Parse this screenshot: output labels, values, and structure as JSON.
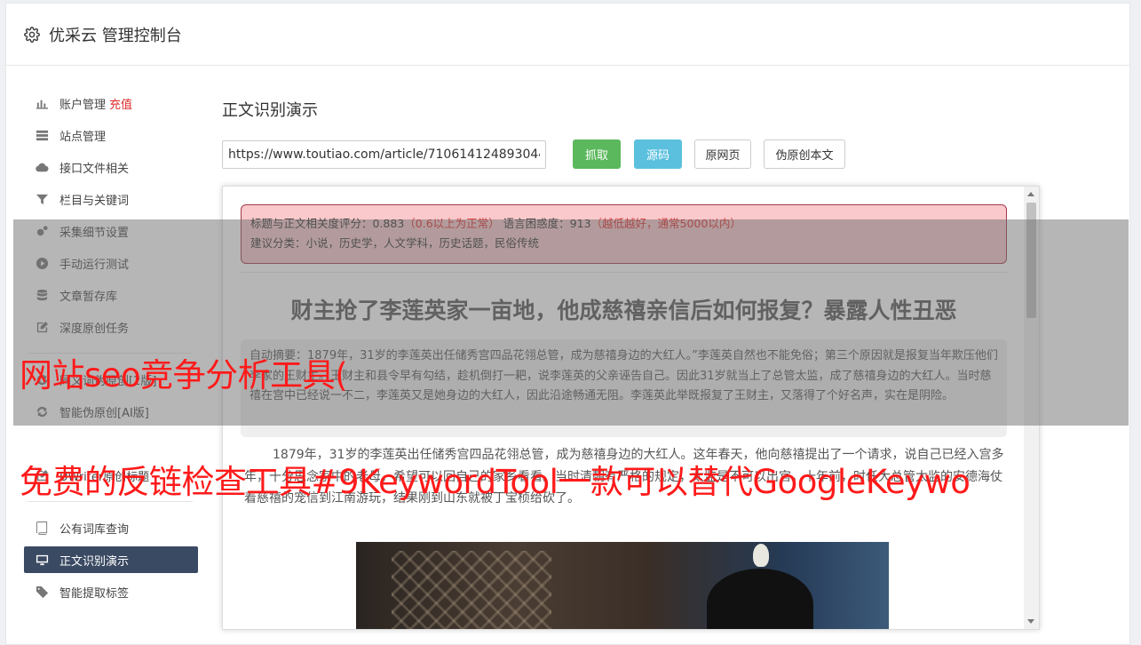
{
  "header": {
    "title": "优采云 管理控制台",
    "icon": "gear-icon"
  },
  "sidebar": {
    "items": [
      {
        "label": "账户管理",
        "extra": "充值",
        "icon": "chart-bar-icon"
      },
      {
        "label": "站点管理",
        "icon": "server-icon"
      },
      {
        "label": "接口文件相关",
        "icon": "cloud-download-icon"
      },
      {
        "label": "栏目与关键词",
        "icon": "filter-icon"
      },
      {
        "label": "采集细节设置",
        "icon": "cogs-icon"
      },
      {
        "label": "手动运行测试",
        "icon": "play-circle-icon"
      },
      {
        "label": "文章暂存库",
        "icon": "database-icon"
      },
      {
        "label": "深度原创任务",
        "icon": "edit-icon"
      },
      {
        "label": "同义词伪原创[2版]",
        "icon": "refresh-icon"
      },
      {
        "label": "智能伪原创[AI版]",
        "icon": "refresh-icon"
      },
      {
        "label": "UWriter原创标题",
        "icon": "edit-icon"
      },
      {
        "label": "公有词库查询",
        "icon": "book-icon"
      },
      {
        "label": "正文识别演示",
        "icon": "desktop-icon",
        "active": true
      },
      {
        "label": "智能提取标签",
        "icon": "tag-icon"
      }
    ]
  },
  "main": {
    "page_title": "正文识别演示",
    "url_value": "https://www.toutiao.com/article/7106141248930447",
    "buttons": {
      "fetch": "抓取",
      "source": "源码",
      "origin": "原网页",
      "rewrite": "伪原创本文"
    },
    "notice": {
      "score_label": "标题与正文相关度评分：0.883",
      "score_hint": "（0.6以上为正常）",
      "confusion_label": "语言困惑度：913",
      "confusion_hint": "（越低越好，通常5000以内）",
      "category": "建议分类：小说，历史学，人文学科，历史话题，民俗传统"
    },
    "article": {
      "title": "财主抢了李莲英家一亩地，他成慈禧亲信后如何报复？暴露人性丑恶",
      "summary": "自动摘要：1879年，31岁的李莲英出任储秀宫四品花翎总管，成为慈禧身边的大红人。”李莲英自然也不能免俗；第三个原因就是报复当年欺压他们李家的王财主。王财主和县令早有勾结，趁机倒打一耙，说李莲英的父亲诬告自己。因此31岁就当上了总管太监，成了慈禧身边的大红人。当时慈禧在宫中已经说一不二，李莲英又是她身边的大红人，因此沿途畅通无阻。李莲英此举既报复了王财主，又落得了个好名声，实在是阴险。",
      "body": "1879年，31岁的李莲英出任储秀宫四品花翎总管，成为慈禧身边的大红人。这年春天，他向慈禧提出了一个请求，说自己已经入宫多年，十分思念家中的老母，希望可以回自己的家乡看看。当时清朝有严格的规定，太监是不可以出宫。十年前，时任大总管太监的安德海仗着慈禧的宠信到江南游玩，结果刚到山东就被丁宝桢给砍了。"
    }
  },
  "overlay": {
    "ad1": "网站seo竞争分析工具(",
    "ad2": "免费的反链检查工具#9KeywordTool一款可以替代GoogleKeywo"
  }
}
